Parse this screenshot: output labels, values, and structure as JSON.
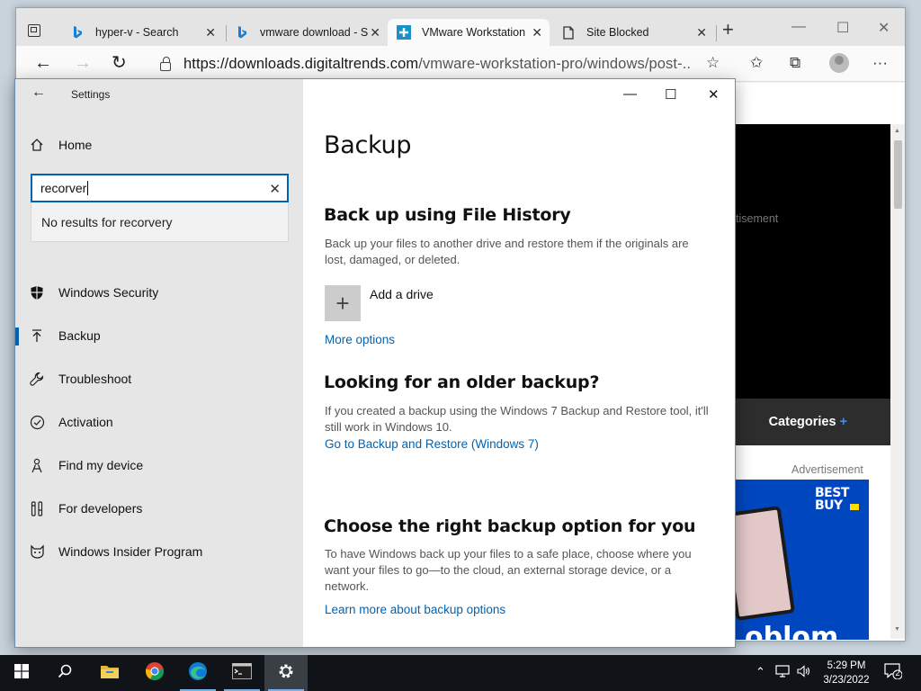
{
  "browser": {
    "tabs": [
      {
        "label": "hyper-v - Search",
        "icon": "bing-icon"
      },
      {
        "label": "vmware download - S",
        "icon": "bing-icon"
      },
      {
        "label": "VMware Workstation",
        "icon": "digitaltrends-icon"
      },
      {
        "label": "Site Blocked",
        "icon": "page-icon"
      }
    ],
    "url_domain": "https://downloads.digitaltrends.com",
    "url_path": "/vmware-workstation-pro/windows/post-...",
    "page": {
      "advertisement_partial": "tisement",
      "categories_label": "Categories",
      "categories_plus": "+",
      "advertisement_label": "Advertisement",
      "ad_brand_line1": "BEST",
      "ad_brand_line2": "BUY",
      "ad_bottom_text": "oblom"
    }
  },
  "settings": {
    "title": "Settings",
    "search": {
      "value": "recorver",
      "no_results": "No results for recorvery"
    },
    "nav": {
      "home": "Home",
      "windows_security": "Windows Security",
      "backup": "Backup",
      "troubleshoot": "Troubleshoot",
      "activation": "Activation",
      "find_my_device": "Find my device",
      "for_developers": "For developers",
      "windows_insider": "Windows Insider Program"
    },
    "content": {
      "title": "Backup",
      "file_history": {
        "heading": "Back up using File History",
        "desc": "Back up your files to another drive and restore them if the originals are lost, damaged, or deleted.",
        "add_drive": "Add a drive",
        "more_options": "More options"
      },
      "older_backup": {
        "heading": "Looking for an older backup?",
        "desc": "If you created a backup using the Windows 7 Backup and Restore tool, it'll still work in Windows 10.",
        "link": "Go to Backup and Restore (Windows 7)"
      },
      "right_option": {
        "heading": "Choose the right backup option for you",
        "desc": "To have Windows back up your files to a safe place, choose where you want your files to go—to the cloud, an external storage device, or a network.",
        "link": "Learn more about backup options"
      }
    }
  },
  "taskbar": {
    "time": "5:29 PM",
    "date": "3/23/2022",
    "notification_count": "2"
  },
  "colors": {
    "accent": "#0063b1",
    "sidebar_bg": "#e6e6e6",
    "taskbar_bg": "#101419"
  }
}
